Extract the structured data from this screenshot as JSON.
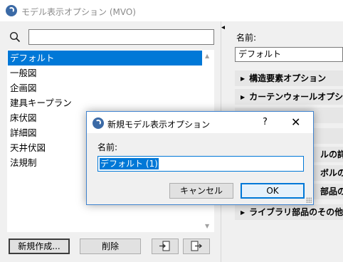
{
  "window": {
    "title": "モデル表示オプション (MVO)"
  },
  "search": {
    "placeholder": ""
  },
  "list": {
    "items": [
      {
        "label": "デフォルト",
        "selected": true
      },
      {
        "label": "一般図",
        "selected": false
      },
      {
        "label": "企画図",
        "selected": false
      },
      {
        "label": "建具キープラン",
        "selected": false
      },
      {
        "label": "床伏図",
        "selected": false
      },
      {
        "label": "詳細図",
        "selected": false
      },
      {
        "label": "天井伏図",
        "selected": false
      },
      {
        "label": "法規制",
        "selected": false
      }
    ]
  },
  "buttons": {
    "new_label": "新規作成...",
    "delete_label": "削除",
    "import_icon": "import-icon",
    "export_icon": "export-icon"
  },
  "right_panel": {
    "name_label": "名前:",
    "name_value": "デフォルト",
    "sections": [
      "構造要素オプション",
      "カーテンウォールオプション",
      "",
      "",
      "ルの詳細",
      "ボルの詳",
      "部品の",
      "ライブラリ部品のその他の詳"
    ]
  },
  "dialog": {
    "title": "新規モデル表示オプション",
    "help": "?",
    "close": "✕",
    "name_label": "名前:",
    "name_value": "デフォルト (1)",
    "cancel_label": "キャンセル",
    "ok_label": "OK"
  },
  "colors": {
    "selection": "#0078d7",
    "accent_border": "#3f83cf"
  }
}
